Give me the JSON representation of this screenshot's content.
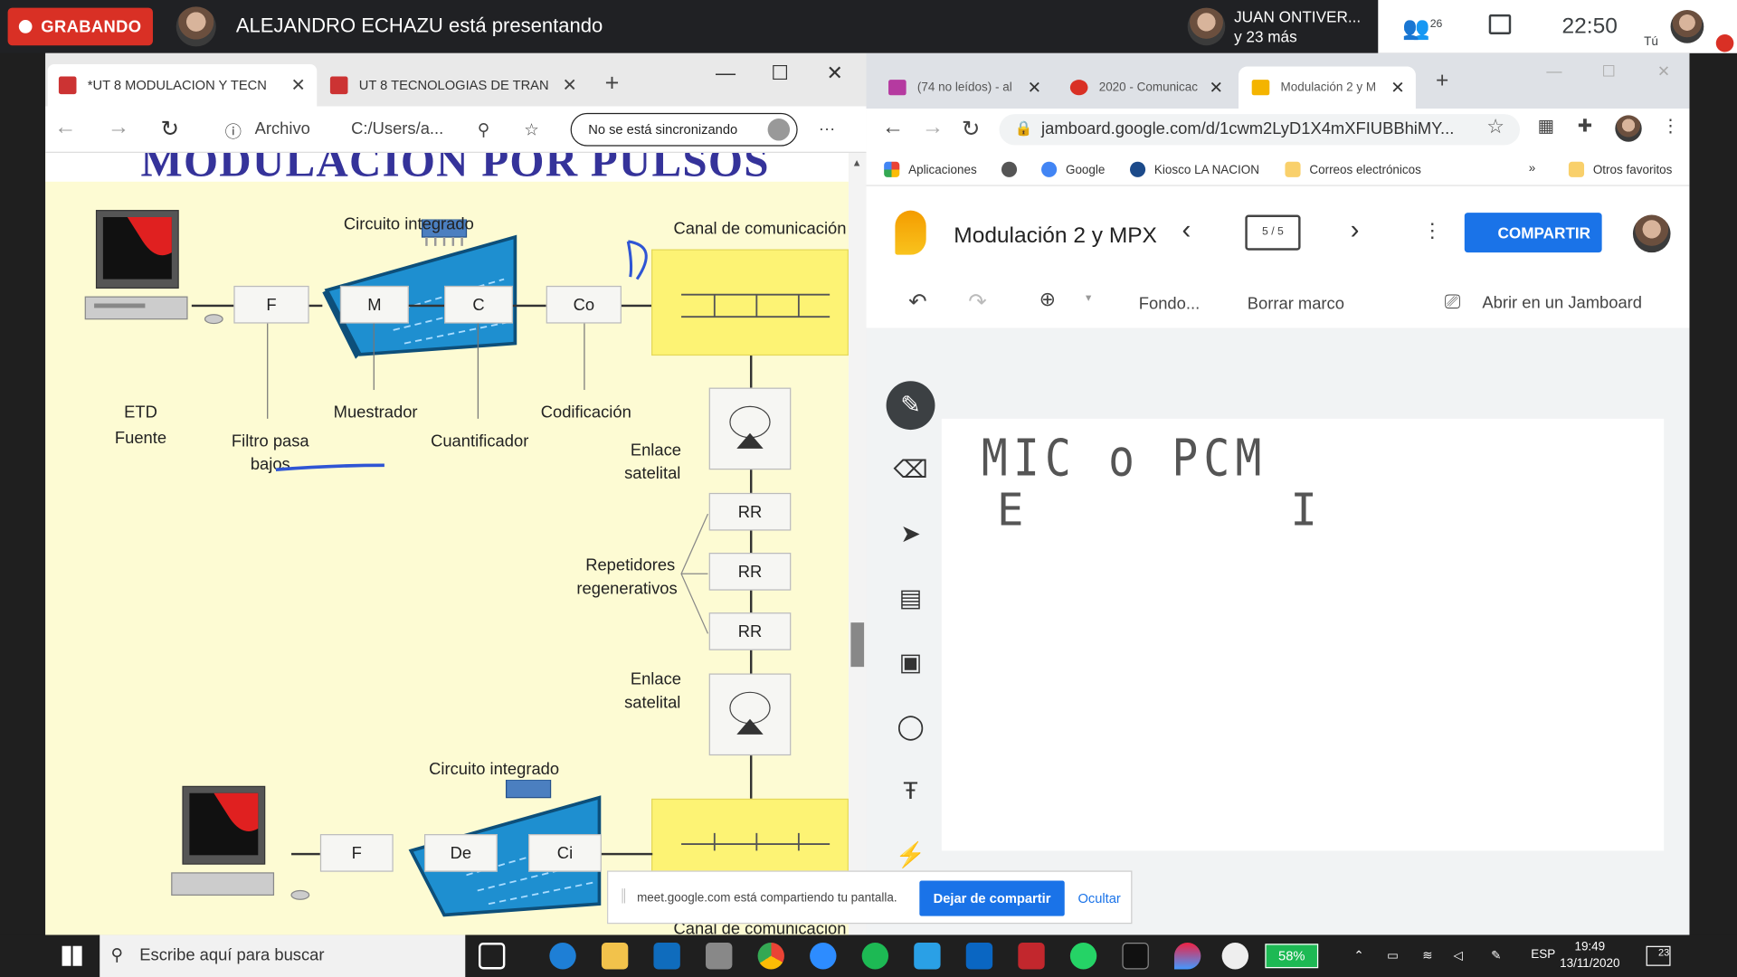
{
  "meet": {
    "recording_label": "GRABANDO",
    "presenter_text": "ALEJANDRO ECHAZU está presentando",
    "others_name": "JUAN ONTIVER...",
    "others_more": "y 23 más",
    "participant_count": "26",
    "clock": "22:50",
    "you_label": "Tú"
  },
  "edge": {
    "tabs": [
      {
        "label": "*UT 8 MODULACION Y TECN"
      },
      {
        "label": "UT 8 TECNOLOGIAS DE TRAN"
      }
    ],
    "address_prefix": "Archivo",
    "address": "C:/Users/a...",
    "sync_label": "No se está sincronizando",
    "more_label": "···"
  },
  "pdf": {
    "title": "MODULACIÓN POR PULSOS",
    "labels": {
      "circuito_integrado_top": "Circuito integrado",
      "canal_top": "Canal de comunicación",
      "etd": "ETD",
      "fuente": "Fuente",
      "filtro": "Filtro pasa",
      "bajos": "bajos",
      "muestrador": "Muestrador",
      "cuantificador": "Cuantificador",
      "codificacion": "Codificación",
      "enlace1": "Enlace",
      "satelital1": "satelital",
      "repetidores": "Repetidores",
      "regenerativos": "regenerativos",
      "enlace2": "Enlace",
      "satelital2": "satelital",
      "circuito_integrado_bottom": "Circuito integrado",
      "canal_bottom": "Canal de comunicación"
    },
    "boxes": {
      "f_top": "F",
      "m": "M",
      "c": "C",
      "co": "Co",
      "rr1": "RR",
      "rr2": "RR",
      "rr3": "RR",
      "f_bottom": "F",
      "de": "De",
      "ci": "Ci"
    }
  },
  "chrome": {
    "tabs": [
      {
        "label": "(74 no leídos) - al"
      },
      {
        "label": "2020 - Comunicac"
      },
      {
        "label": "Modulación 2 y M"
      }
    ],
    "url": "jamboard.google.com/d/1cwm2LyD1X4mXFIUBBhiMY...",
    "bookmarks": [
      "Aplicaciones",
      "Google",
      "Kiosco LA NACION",
      "Correos electrónicos",
      "Otros favoritos"
    ]
  },
  "jamboard": {
    "title": "Modulación 2 y MPX",
    "frame_counter": "5 / 5",
    "share_label": "COMPARTIR",
    "toolbar": {
      "background": "Fondo...",
      "clear": "Borrar marco",
      "open_in": "Abrir en un Jamboard"
    },
    "handwriting_line1": "MIC o PCM",
    "handwriting_line2": "E          I"
  },
  "share_bar": {
    "message": "meet.google.com está compartiendo tu pantalla.",
    "stop_label": "Dejar de compartir",
    "hide_label": "Ocultar"
  },
  "taskbar": {
    "search_placeholder": "Escribe aquí para buscar",
    "battery": "58%",
    "language": "ESP",
    "time": "19:49",
    "date": "13/11/2020",
    "notifications": "23"
  }
}
